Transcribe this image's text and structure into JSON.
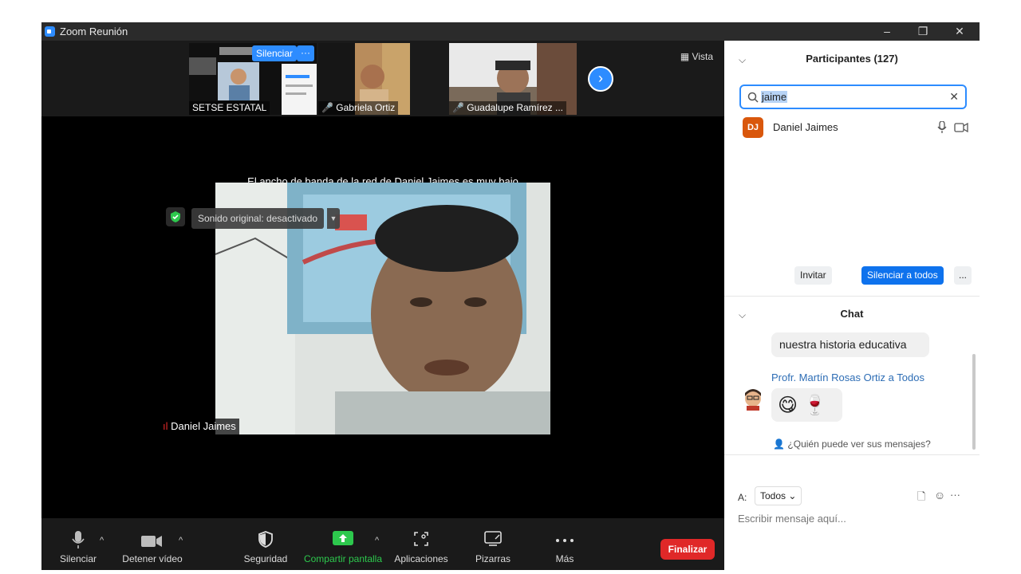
{
  "window": {
    "title": "Zoom Reunión"
  },
  "strip": {
    "vista_label": "Vista",
    "silence_chip": "Silenciar",
    "more_chip": "···",
    "thumbnails": [
      {
        "name": "SETSE ESTATAL"
      },
      {
        "name": "Gabriela Ortiz"
      },
      {
        "name": "Guadalupe Ramírez ..."
      }
    ]
  },
  "main": {
    "bandwidth_notice": "El ancho de banda de la red de Daniel Jaimes es muy bajo",
    "original_sound": "Sonido original: desactivado",
    "speaker_name": "Daniel Jaimes"
  },
  "toolbar": {
    "mute": "Silenciar",
    "video": "Detener vídeo",
    "security": "Seguridad",
    "share": "Compartir pantalla",
    "apps": "Aplicaciones",
    "whiteboards": "Pizarras",
    "more": "Más",
    "end": "Finalizar",
    "share_color": "#2dc84d"
  },
  "participants": {
    "header": "Participantes (127)",
    "search_value": "jaime",
    "list": [
      {
        "initials": "DJ",
        "name": "Daniel Jaimes"
      }
    ],
    "invite": "Invitar",
    "mute_all": "Silenciar a todos",
    "more": "..."
  },
  "chat": {
    "header": "Chat",
    "prev_message_tail": "nuestra historia educativa",
    "sender": "Profr. Martín Rosas Ortiz a Todos",
    "emoji_message": "😋 🍷",
    "who_can_see": "¿Quién puede ver sus mensajes?",
    "to_label": "A:",
    "to_value": "Todos",
    "input_placeholder": "Escribir mensaje aquí..."
  },
  "colors": {
    "accent": "#2d8cff",
    "end": "#e02828",
    "avatar": "#d9570c"
  }
}
